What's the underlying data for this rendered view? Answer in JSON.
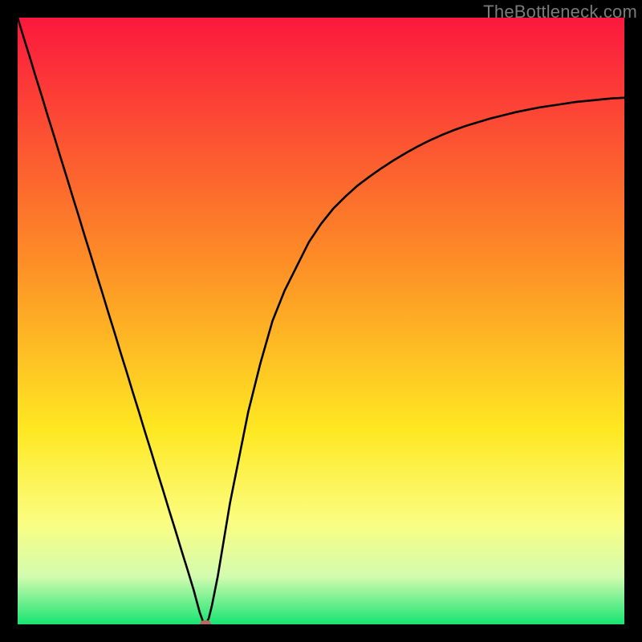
{
  "watermark": "TheBottleneck.com",
  "colors": {
    "top": "#fb183e",
    "mid1": "#fd8d26",
    "mid2": "#fee822",
    "mid3": "#fbfd80",
    "mid4": "#d4fcaf",
    "bottom": "#18e472",
    "frame": "#000000",
    "curve": "#000000",
    "marker": "#b56b64"
  },
  "chart_data": {
    "type": "line",
    "title": "",
    "xlabel": "",
    "ylabel": "",
    "xlim": [
      0,
      100
    ],
    "ylim": [
      0,
      100
    ],
    "x": [
      0,
      1,
      2,
      3,
      4,
      5,
      6,
      7,
      8,
      9,
      10,
      11,
      12,
      13,
      14,
      15,
      16,
      17,
      18,
      19,
      20,
      21,
      22,
      23,
      24,
      25,
      26,
      27,
      28,
      29,
      30,
      30.5,
      31,
      31.5,
      32,
      33,
      34,
      35,
      36,
      37,
      38,
      39,
      40,
      42,
      44,
      46,
      48,
      50,
      52,
      54,
      56,
      58,
      60,
      62,
      64,
      66,
      68,
      70,
      72,
      74,
      76,
      78,
      80,
      82,
      84,
      86,
      88,
      90,
      92,
      94,
      96,
      98,
      100
    ],
    "values": [
      100.0,
      96.7,
      93.5,
      90.2,
      87.0,
      83.7,
      80.5,
      77.2,
      74.0,
      70.7,
      67.5,
      64.2,
      61.0,
      57.7,
      54.5,
      51.2,
      48.0,
      44.7,
      41.5,
      38.2,
      35.0,
      31.7,
      28.5,
      25.2,
      22.0,
      18.7,
      15.5,
      12.2,
      9.0,
      5.7,
      2.0,
      0.6,
      0.0,
      1.0,
      3.0,
      8.0,
      14.0,
      20.0,
      25.0,
      30.0,
      35.0,
      39.0,
      43.0,
      50.0,
      55.0,
      59.0,
      63.0,
      66.0,
      68.5,
      70.5,
      72.3,
      73.8,
      75.2,
      76.5,
      77.7,
      78.8,
      79.8,
      80.7,
      81.5,
      82.2,
      82.8,
      83.4,
      83.9,
      84.4,
      84.8,
      85.2,
      85.5,
      85.8,
      86.1,
      86.3,
      86.5,
      86.7,
      86.8
    ],
    "marker": {
      "x": 31,
      "y": 0
    },
    "gradient_stops": [
      {
        "pct": 0,
        "color": "#fb183e"
      },
      {
        "pct": 40,
        "color": "#fd8d26"
      },
      {
        "pct": 68,
        "color": "#fee822"
      },
      {
        "pct": 83,
        "color": "#fbfd80"
      },
      {
        "pct": 92,
        "color": "#d4fcaf"
      },
      {
        "pct": 100,
        "color": "#18e472"
      }
    ]
  }
}
